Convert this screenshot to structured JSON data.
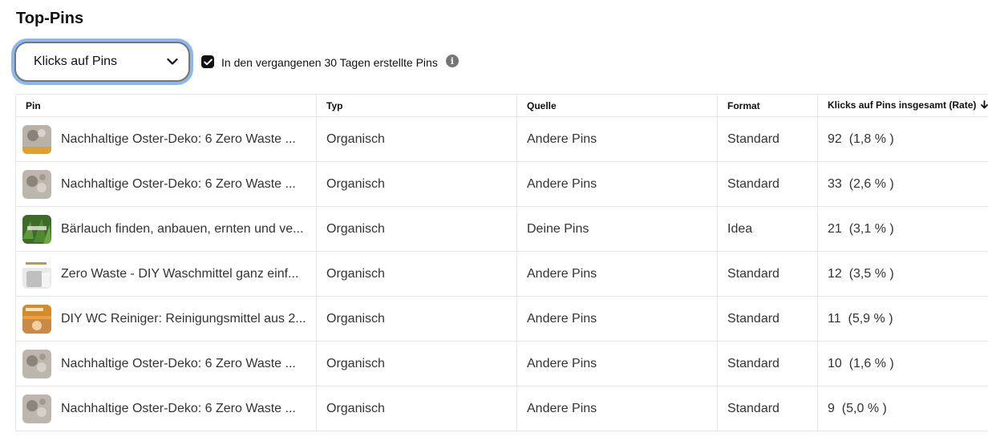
{
  "header": {
    "title": "Top-Pins"
  },
  "filters": {
    "dropdown_value": "Klicks auf Pins",
    "checkbox_label": "In den vergangenen 30 Tagen erstellte Pins",
    "checkbox_checked": true
  },
  "table": {
    "columns": [
      "Pin",
      "Typ",
      "Quelle",
      "Format",
      "Klicks auf Pins insgesamt (Rate)"
    ],
    "sorted_column": "Klicks auf Pins insgesamt (Rate)",
    "rows": [
      {
        "title": "Nachhaltige Oster-Deko: 6 Zero Waste ...",
        "type": "Organisch",
        "source": "Andere Pins",
        "format": "Standard",
        "clicks": "92",
        "rate": "(1,8 % )"
      },
      {
        "title": "Nachhaltige Oster-Deko: 6 Zero Waste ...",
        "type": "Organisch",
        "source": "Andere Pins",
        "format": "Standard",
        "clicks": "33",
        "rate": "(2,6 % )"
      },
      {
        "title": "Bärlauch finden, anbauen, ernten und ve...",
        "type": "Organisch",
        "source": "Deine Pins",
        "format": "Idea",
        "clicks": "21",
        "rate": "(3,1 % )"
      },
      {
        "title": "Zero Waste - DIY Waschmittel ganz einf...",
        "type": "Organisch",
        "source": "Andere Pins",
        "format": "Standard",
        "clicks": "12",
        "rate": "(3,5 % )"
      },
      {
        "title": "DIY WC Reiniger: Reinigungsmittel aus 2...",
        "type": "Organisch",
        "source": "Andere Pins",
        "format": "Standard",
        "clicks": "11",
        "rate": "(5,9 % )"
      },
      {
        "title": "Nachhaltige Oster-Deko: 6 Zero Waste ...",
        "type": "Organisch",
        "source": "Andere Pins",
        "format": "Standard",
        "clicks": "10",
        "rate": "(1,6 % )"
      },
      {
        "title": "Nachhaltige Oster-Deko: 6 Zero Waste ...",
        "type": "Organisch",
        "source": "Andere Pins",
        "format": "Standard",
        "clicks": "9",
        "rate": "(5,0 % )"
      }
    ]
  }
}
